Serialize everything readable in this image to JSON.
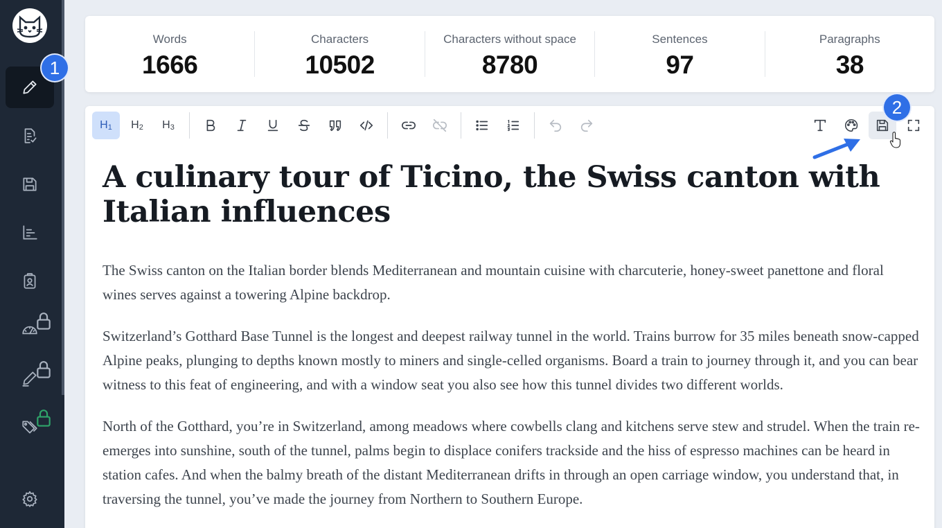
{
  "sidebar": {
    "logo_icon": "cat-icon",
    "items": [
      {
        "icon": "pencil-icon",
        "active": true
      },
      {
        "icon": "document-check-icon"
      },
      {
        "icon": "save-icon"
      },
      {
        "icon": "chart-icon"
      },
      {
        "icon": "clipboard-user-icon"
      },
      {
        "icon": "gauge-icon",
        "locked": true
      },
      {
        "icon": "pen-icon",
        "locked": true
      },
      {
        "icon": "tags-icon",
        "locked": true,
        "lock_color": "#2fa56a"
      },
      {
        "icon": "gear-icon"
      }
    ]
  },
  "badges": {
    "first": "1",
    "second": "2"
  },
  "stats": [
    {
      "label": "Words",
      "value": "1666"
    },
    {
      "label": "Characters",
      "value": "10502"
    },
    {
      "label": "Characters without space",
      "value": "8780"
    },
    {
      "label": "Sentences",
      "value": "97"
    },
    {
      "label": "Paragraphs",
      "value": "38"
    }
  ],
  "toolbar": {
    "h1": "H",
    "h1_sub": "1",
    "h2": "H",
    "h2_sub": "2",
    "h3": "H",
    "h3_sub": "3"
  },
  "document": {
    "title": "A culinary tour of Ticino, the Swiss canton with Italian influences",
    "paragraphs": [
      "The Swiss canton on the Italian border blends Mediterranean and mountain cuisine with charcuterie, honey-sweet panettone and floral wines serves against a towering Alpine backdrop.",
      "Switzerland’s Gotthard Base Tunnel is the longest and deepest railway tunnel in the world. Trains burrow for 35 miles beneath snow-capped Alpine peaks, plunging to depths known mostly to miners and single-celled organisms. Board a train to journey through it, and you can bear witness to this feat of engineering, and with a window seat you also see how this tunnel divides two different worlds.",
      "North of the Gotthard, you’re in Switzerland, among meadows where cowbells clang and kitchens serve stew and strudel. When the train re-emerges into sunshine, south of the tunnel, palms begin to displace conifers trackside and the hiss of espresso machines can be heard in station cafes. And when the balmy breath of the distant Mediterranean drifts in through an open carriage window, you understand that, in traversing the tunnel, you’ve made the journey from Northern to Southern Europe."
    ]
  },
  "colors": {
    "sidebar_bg": "#1e2836",
    "accent": "#2f6fe6",
    "active_heading": "#cfe0fb"
  }
}
